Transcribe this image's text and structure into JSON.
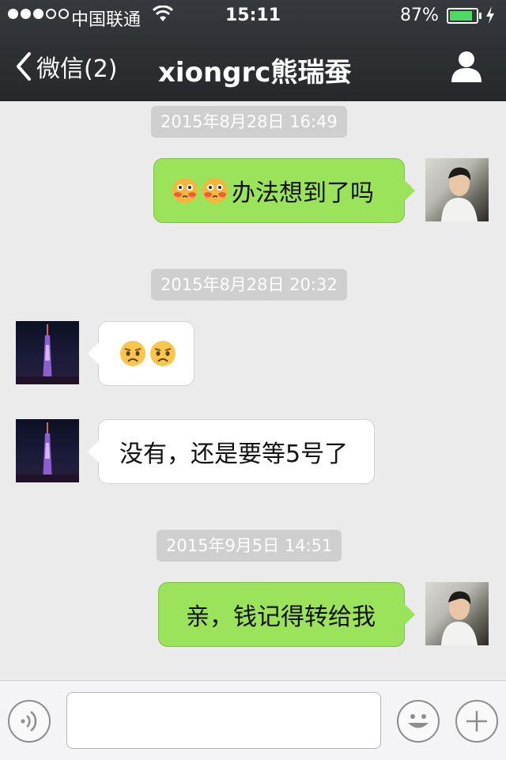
{
  "status_bar": {
    "carrier": "中国联通",
    "time": "15:11",
    "battery": "87%",
    "battery_level": 0.87,
    "signal_bars": 3,
    "signal_total": 5
  },
  "nav": {
    "back_label": "微信(2)",
    "title": "xiongrc熊瑞蚕"
  },
  "messages": [
    {
      "timestamp": "2015年8月28日 16:49",
      "direction": "sent",
      "text": "办法想到了吗",
      "emojis": [
        "blushing-face-icon",
        "blushing-face-icon"
      ]
    },
    {
      "timestamp": "2015年8月28日 20:32",
      "direction": "received",
      "text": "",
      "emojis": [
        "sad-face-icon",
        "sad-face-icon"
      ]
    },
    {
      "direction": "received",
      "text": "没有，还是要等5号了"
    },
    {
      "timestamp": "2015年9月5日 14:51",
      "direction": "sent",
      "text": "亲，钱记得转给我"
    }
  ],
  "input": {
    "value": "",
    "placeholder": ""
  },
  "colors": {
    "sent_bubble": "#9be35b",
    "received_bubble": "#ffffff",
    "nav_background": "#2e3033",
    "chat_background": "#ebebeb"
  }
}
